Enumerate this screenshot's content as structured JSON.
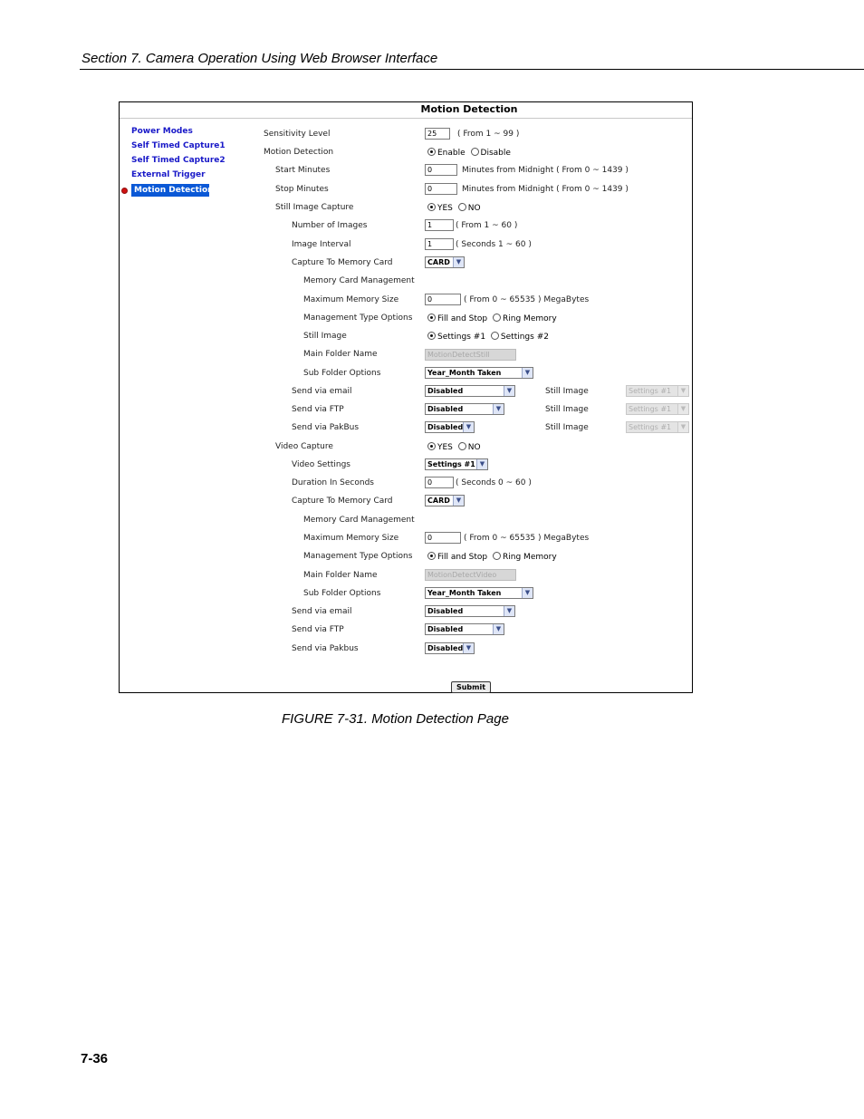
{
  "header": {
    "section_title": "Section 7.  Camera Operation Using Web Browser Interface"
  },
  "figure": {
    "title": "Motion Detection",
    "nav": [
      {
        "label": "Power Modes"
      },
      {
        "label": "Self Timed Capture1"
      },
      {
        "label": "Self Timed Capture2"
      },
      {
        "label": "External Trigger"
      },
      {
        "label": "Motion Detection",
        "active": true
      }
    ],
    "labels": {
      "sensitivity": "Sensitivity Level",
      "motion_detection": "Motion Detection",
      "start_minutes": "Start Minutes",
      "stop_minutes": "Stop Minutes",
      "still_capture": "Still Image Capture",
      "num_images": "Number of Images",
      "image_interval": "Image Interval",
      "capture_card": "Capture To Memory Card",
      "mcm": "Memory Card Management",
      "max_mem": "Maximum Memory Size",
      "mgmt_type": "Management Type Options",
      "still_image": "Still Image",
      "main_folder": "Main Folder Name",
      "sub_folder": "Sub Folder Options",
      "send_email": "Send via email",
      "send_ftp": "Send via FTP",
      "send_pakbus": "Send via PakBus",
      "video_capture": "Video Capture",
      "video_settings": "Video Settings",
      "duration": "Duration In Seconds",
      "v_capture_card": "Capture To Memory Card",
      "v_mcm": "Memory Card Management",
      "v_max_mem": "Maximum Memory Size",
      "v_mgmt_type": "Management Type Options",
      "v_main_folder": "Main Folder Name",
      "v_sub_folder": "Sub Folder Options",
      "v_send_email": "Send via email",
      "v_send_ftp": "Send via FTP",
      "v_send_pakbus": "Send via Pakbus",
      "still_image_email": "Still Image",
      "still_image_ftp": "Still Image",
      "still_image_pakbus": "Still Image"
    },
    "values": {
      "sensitivity": "25",
      "start_minutes": "0",
      "stop_minutes": "0",
      "num_images": "1",
      "image_interval": "1",
      "max_mem": "0",
      "main_folder": "MotionDetectStill",
      "duration": "0",
      "v_max_mem": "0",
      "v_main_folder": "MotionDetectVideo"
    },
    "hints": {
      "sensitivity": "( From 1 ~ 99 )",
      "start_minutes": "Minutes from Midnight ( From 0 ~ 1439 )",
      "stop_minutes": "Minutes from Midnight ( From 0 ~ 1439 )",
      "num_images": "( From 1 ~ 60 )",
      "image_interval": "( Seconds 1 ~ 60 )",
      "max_mem": "( From 0 ~ 65535 ) MegaBytes",
      "duration": "( Seconds 0 ~ 60 )",
      "v_max_mem": "( From 0 ~ 65535 ) MegaBytes"
    },
    "radios": {
      "enable": "Enable",
      "disable": "Disable",
      "yes": "YES",
      "no": "NO",
      "fill_stop": "Fill and Stop",
      "ring_memory": "Ring Memory",
      "settings1": "Settings #1",
      "settings2": "Settings #2"
    },
    "selects": {
      "capture_card": "CARD",
      "sub_folder": "Year_Month Taken",
      "send_email": "Disabled",
      "send_ftp": "Disabled",
      "send_pakbus": "Disabled",
      "still_email": "Settings #1",
      "still_ftp": "Settings #1",
      "still_pakbus": "Settings #1",
      "video_settings": "Settings #1",
      "v_capture_card": "CARD",
      "v_sub_folder": "Year_Month Taken",
      "v_send_email": "Disabled",
      "v_send_ftp": "Disabled",
      "v_send_pakbus": "Disabled"
    },
    "submit_label": "Submit"
  },
  "caption": "FIGURE 7-31.  Motion Detection Page",
  "page_number": "7-36"
}
